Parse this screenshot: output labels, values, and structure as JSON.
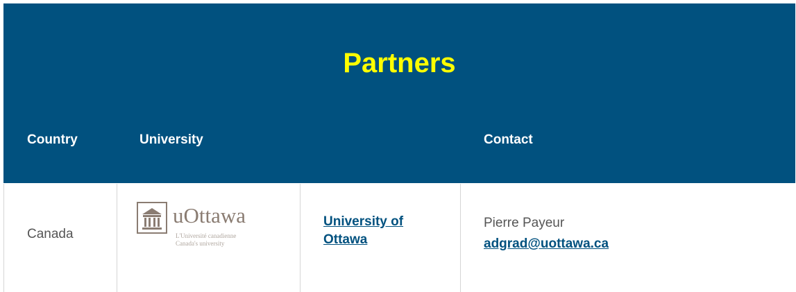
{
  "section": {
    "title": "Partners"
  },
  "table": {
    "headers": {
      "country": "Country",
      "university": "University",
      "contact": "Contact"
    },
    "rows": [
      {
        "country": "Canada",
        "logo": {
          "icon": "university-building-icon",
          "wordmark": "uOttawa",
          "tagline_fr": "L'Université canadienne",
          "tagline_en": "Canada's university"
        },
        "university_link": "University of Ottawa",
        "contact_name": "Pierre Payeur",
        "contact_email": "adgrad@uottawa.ca"
      }
    ]
  },
  "colors": {
    "header_bg": "#01517f",
    "title": "#ffff00",
    "header_text": "#ffffff",
    "link": "#01517f",
    "body_text": "#555555",
    "divider": "#d5d5d5"
  }
}
